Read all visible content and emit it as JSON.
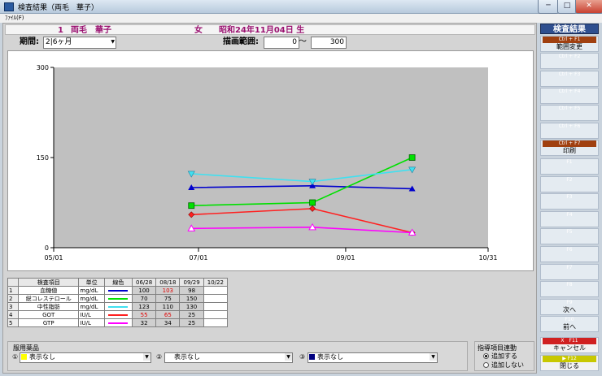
{
  "window": {
    "title": "検査結果（両毛　華子）",
    "min": "─",
    "max": "□",
    "close": "✕"
  },
  "menu": {
    "file": "ﾌｧｲﾙ(F)"
  },
  "patient": {
    "number": "1",
    "name": "両毛　華子",
    "sex": "女",
    "birth": "昭和24年11月04日 生"
  },
  "controls": {
    "period_label": "期間:",
    "period_value": "2|6ヶ月",
    "range_label": "描画範囲:",
    "range_min": "0",
    "range_sep": "～",
    "range_max": "300"
  },
  "chart_data": {
    "type": "line",
    "x_tick_labels": [
      "05/01",
      "07/01",
      "09/01",
      "10/31"
    ],
    "y_tick_labels": [
      "0",
      "150",
      "300"
    ],
    "ylim": [
      0,
      300
    ],
    "x_dates": [
      "06/28",
      "08/18",
      "09/29"
    ],
    "series": [
      {
        "name": "血糖値",
        "color": "#0000cc",
        "values": [
          100,
          103,
          98
        ],
        "marker": "triangle-filled"
      },
      {
        "name": "総コレステロール",
        "color": "#00e000",
        "values": [
          70,
          75,
          150
        ],
        "marker": "square"
      },
      {
        "name": "中性脂肪",
        "color": "#40e0f0",
        "values": [
          123,
          110,
          130
        ],
        "marker": "triangle-down"
      },
      {
        "name": "GOT",
        "color": "#ff2020",
        "values": [
          55,
          65,
          25
        ],
        "marker": "diamond"
      },
      {
        "name": "GTP",
        "color": "#ff00ff",
        "values": [
          32,
          34,
          25
        ],
        "marker": "triangle-open"
      }
    ]
  },
  "table": {
    "headers": [
      "",
      "検査項目",
      "単位",
      "線色",
      "06/28",
      "08/18",
      "09/29",
      "10/22"
    ],
    "rows": [
      {
        "idx": "1",
        "name": "血糖値",
        "unit": "mg/dL",
        "color": "#0000cc",
        "v": [
          "100",
          "103",
          "98",
          ""
        ],
        "red": [
          false,
          true,
          false,
          false
        ]
      },
      {
        "idx": "2",
        "name": "総コレステロール",
        "unit": "mg/dL",
        "color": "#00e000",
        "v": [
          "70",
          "75",
          "150",
          ""
        ],
        "red": [
          false,
          false,
          false,
          false
        ]
      },
      {
        "idx": "3",
        "name": "中性脂肪",
        "unit": "mg/dL",
        "color": "#40e0f0",
        "v": [
          "123",
          "110",
          "130",
          ""
        ],
        "red": [
          false,
          false,
          false,
          false
        ]
      },
      {
        "idx": "4",
        "name": "GOT",
        "unit": "IU/L",
        "color": "#ff2020",
        "v": [
          "55",
          "65",
          "25",
          ""
        ],
        "red": [
          true,
          true,
          false,
          false
        ]
      },
      {
        "idx": "5",
        "name": "GTP",
        "unit": "IU/L",
        "color": "#ff00ff",
        "v": [
          "32",
          "34",
          "25",
          ""
        ],
        "red": [
          false,
          false,
          false,
          false
        ]
      }
    ]
  },
  "medicine": {
    "label": "服用薬品",
    "slots": [
      {
        "num": "①",
        "value": "表示なし",
        "color": "#ffff00"
      },
      {
        "num": "②",
        "value": "表示なし",
        "color": "#ffffff"
      },
      {
        "num": "③",
        "value": "表示なし",
        "color": "#000080"
      }
    ]
  },
  "guide": {
    "label": "指導項目連動",
    "opt_yes": "追加する",
    "opt_no": "追加しない"
  },
  "sidebar": {
    "header": "検査結果",
    "ctrl_buttons": [
      {
        "key": "Ctrl + F1",
        "label": "範囲変更",
        "active": true
      },
      {
        "key": "Ctrl + F2",
        "label": "",
        "active": false
      },
      {
        "key": "Ctrl + F3",
        "label": "",
        "active": false
      },
      {
        "key": "Ctrl + F4",
        "label": "",
        "active": false
      },
      {
        "key": "Ctrl + F5",
        "label": "",
        "active": false
      },
      {
        "key": "Ctrl + F6",
        "label": "",
        "active": false
      },
      {
        "key": "Ctrl + F7",
        "label": "印刷",
        "active": true
      }
    ],
    "f_buttons": [
      {
        "key": "F1",
        "label": ""
      },
      {
        "key": "F2",
        "label": ""
      },
      {
        "key": "F3",
        "label": ""
      },
      {
        "key": "F4",
        "label": ""
      },
      {
        "key": "F5",
        "label": ""
      },
      {
        "key": "F6",
        "label": ""
      },
      {
        "key": "F7",
        "label": ""
      },
      {
        "key": "F8",
        "label": ""
      },
      {
        "key": "F9",
        "label": "次へ"
      },
      {
        "key": "F10",
        "label": "前へ"
      }
    ],
    "cancel": {
      "key": "X　F11",
      "label": "キャンセル"
    },
    "close": {
      "key": "▶ F12",
      "label": "閉じる"
    }
  }
}
